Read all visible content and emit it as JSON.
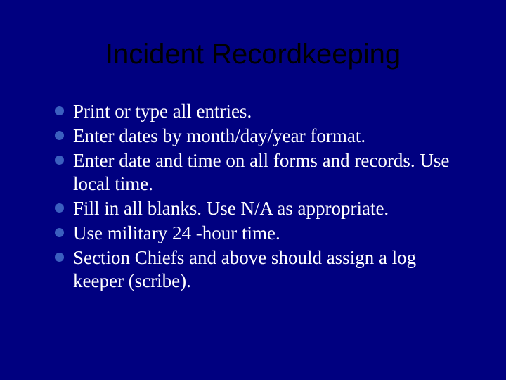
{
  "slide": {
    "title": "Incident Recordkeeping",
    "bullets": [
      "Print or type all entries.",
      "Enter dates by month/day/year format.",
      "Enter date and time on all forms and records. Use local time.",
      "Fill in all blanks. Use N/A as appropriate.",
      "Use military 24 -hour time.",
      "Section Chiefs and above should assign a log keeper (scribe)."
    ]
  }
}
